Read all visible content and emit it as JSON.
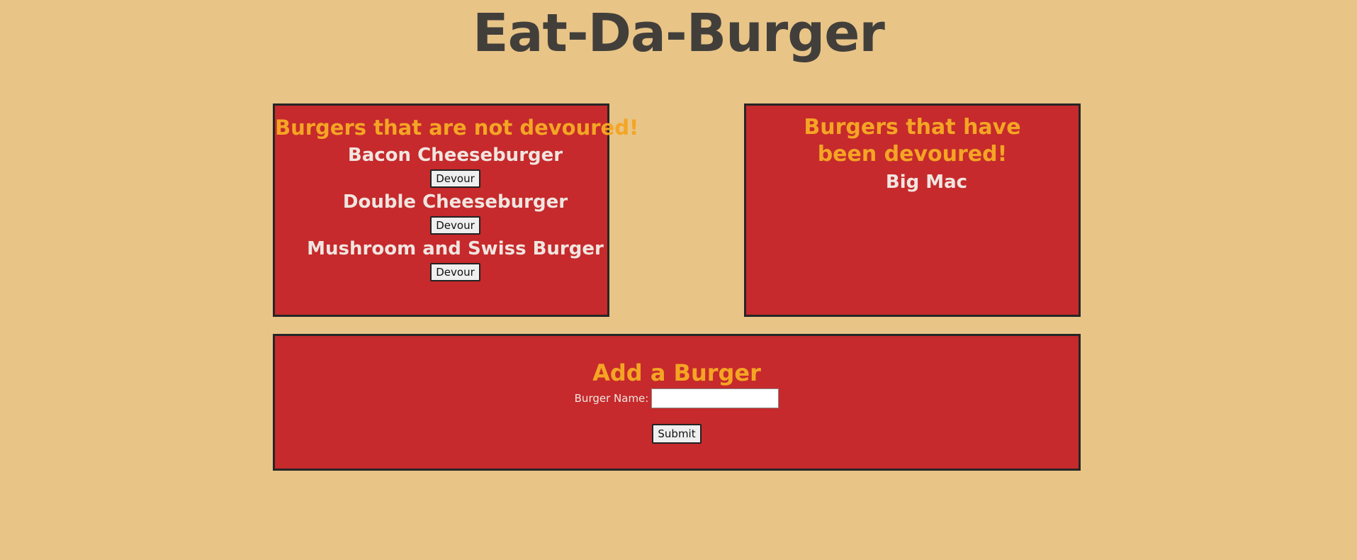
{
  "app": {
    "title": "Eat-Da-Burger"
  },
  "not_devoured": {
    "heading": "Burgers that are not devoured!",
    "burgers": [
      {
        "name": "Bacon Cheeseburger",
        "button_label": "Devour"
      },
      {
        "name": "Double Cheeseburger",
        "button_label": "Devour"
      },
      {
        "name": "Mushroom and Swiss Burger",
        "button_label": "Devour"
      }
    ]
  },
  "devoured": {
    "heading": "Burgers that have been devoured!",
    "burgers": [
      {
        "name": "Big Mac"
      }
    ]
  },
  "add_form": {
    "heading": "Add a Burger",
    "label": "Burger Name:",
    "input_value": "",
    "submit_label": "Submit"
  },
  "colors": {
    "background": "#e8c487",
    "panel": "#c62a2c",
    "heading_orange": "#f4a524",
    "title_text": "#423f3b"
  }
}
